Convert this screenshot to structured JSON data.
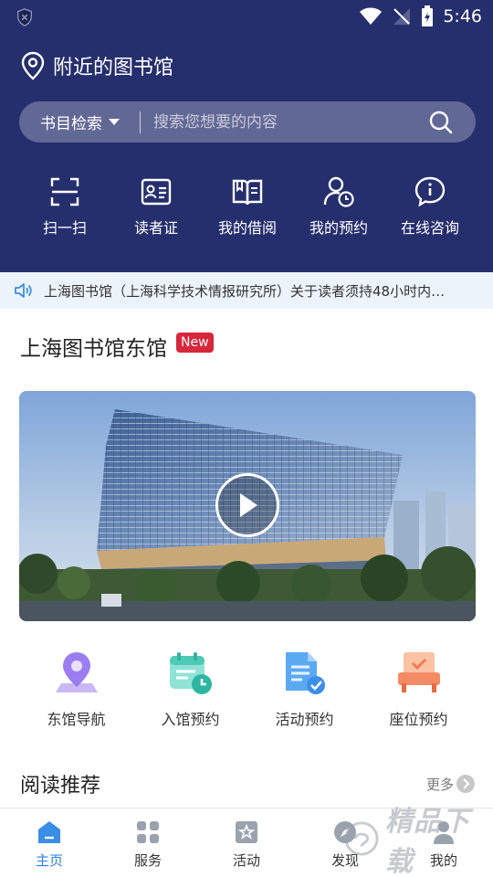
{
  "status": {
    "time": "5:46"
  },
  "header": {
    "title": "附近的图书馆"
  },
  "search": {
    "category": "书目检索",
    "placeholder": "搜索您想要的内容"
  },
  "quick_actions": [
    {
      "label": "扫一扫",
      "icon": "scan-icon"
    },
    {
      "label": "读者证",
      "icon": "reader-card-icon"
    },
    {
      "label": "我的借阅",
      "icon": "book-icon"
    },
    {
      "label": "我的预约",
      "icon": "user-clock-icon"
    },
    {
      "label": "在线咨询",
      "icon": "chat-info-icon"
    }
  ],
  "notice": {
    "text": "上海图书馆（上海科学技术情报研究所）关于读者须持48小时内…"
  },
  "library": {
    "title": "上海图书馆东馆",
    "badge": "New"
  },
  "services": [
    {
      "label": "东馆导航",
      "icon": "navigation-pin-icon"
    },
    {
      "label": "入馆预约",
      "icon": "calendar-clock-icon"
    },
    {
      "label": "活动预约",
      "icon": "document-check-icon"
    },
    {
      "label": "座位预约",
      "icon": "seat-icon"
    }
  ],
  "recommend": {
    "title": "阅读推荐",
    "more": "更多"
  },
  "tabs": [
    {
      "label": "主页",
      "icon": "home-icon",
      "active": true
    },
    {
      "label": "服务",
      "icon": "grid-icon",
      "active": false
    },
    {
      "label": "活动",
      "icon": "star-box-icon",
      "active": false
    },
    {
      "label": "发现",
      "icon": "compass-icon",
      "active": false
    },
    {
      "label": "我的",
      "icon": "profile-icon",
      "active": false
    }
  ],
  "colors": {
    "header_bg": "#262f6d",
    "accent": "#2f7ee6",
    "badge": "#d8263a",
    "notice_bg": "#ecf3fb"
  },
  "watermark": {
    "text": "精品下载"
  }
}
